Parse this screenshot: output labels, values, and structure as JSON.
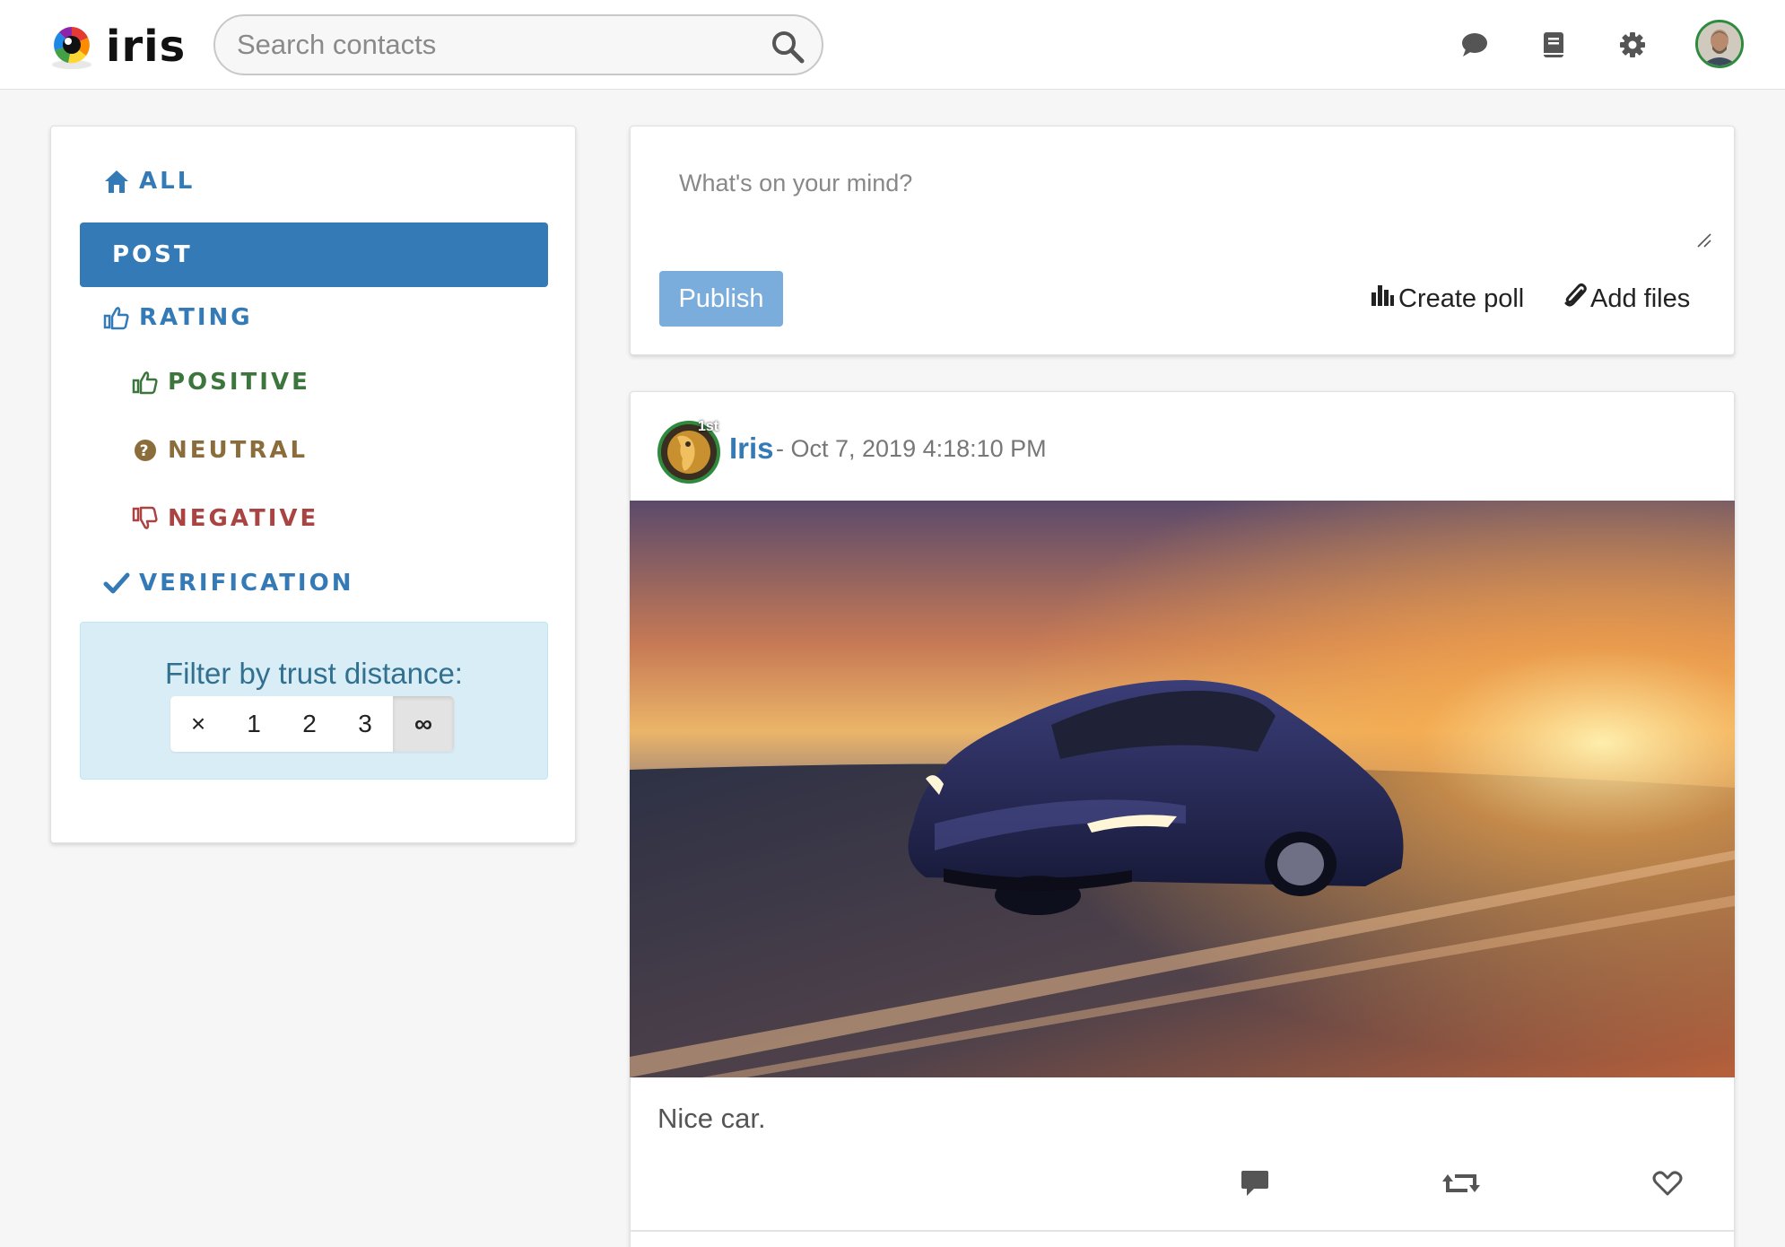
{
  "header": {
    "logo_text": "iris",
    "search_placeholder": "Search contacts",
    "icons": [
      "chat-icon",
      "book-icon",
      "gear-icon",
      "avatar"
    ]
  },
  "sidebar": {
    "items": [
      {
        "label": "ALL",
        "icon": "home-icon",
        "color": "#337ab7",
        "active": false
      },
      {
        "label": "POST",
        "icon": "",
        "color": "#ffffff",
        "active": true
      },
      {
        "label": "RATING",
        "icon": "thumbs-up-icon",
        "color": "#337ab7",
        "active": false
      },
      {
        "label": "POSITIVE",
        "icon": "thumbs-up-icon",
        "color": "#3c763d",
        "active": false
      },
      {
        "label": "NEUTRAL",
        "icon": "question-circle-icon",
        "color": "#8a6d3b",
        "active": false
      },
      {
        "label": "NEGATIVE",
        "icon": "thumbs-down-icon",
        "color": "#a94442",
        "active": false
      },
      {
        "label": "VERIFICATION",
        "icon": "check-icon",
        "color": "#337ab7",
        "active": false
      }
    ],
    "trust_filter": {
      "label": "Filter by trust distance:",
      "options": [
        "×",
        "1",
        "2",
        "3",
        "∞"
      ],
      "selected": "∞"
    }
  },
  "composer": {
    "placeholder": "What's on your mind?",
    "publish_label": "Publish",
    "create_poll_label": "Create poll",
    "add_files_label": "Add files"
  },
  "post": {
    "author": "Iris",
    "degree": "1st",
    "date": "- Oct 7, 2019 4:18:10 PM",
    "text": "Nice car.",
    "actions": [
      "comment-icon",
      "retweet-icon",
      "heart-icon"
    ]
  },
  "colors": {
    "primary": "#337ab7",
    "publish_button": "#7aaddb",
    "trust_box_bg": "#d9edf7",
    "avatar_border": "#2e8b3e"
  }
}
